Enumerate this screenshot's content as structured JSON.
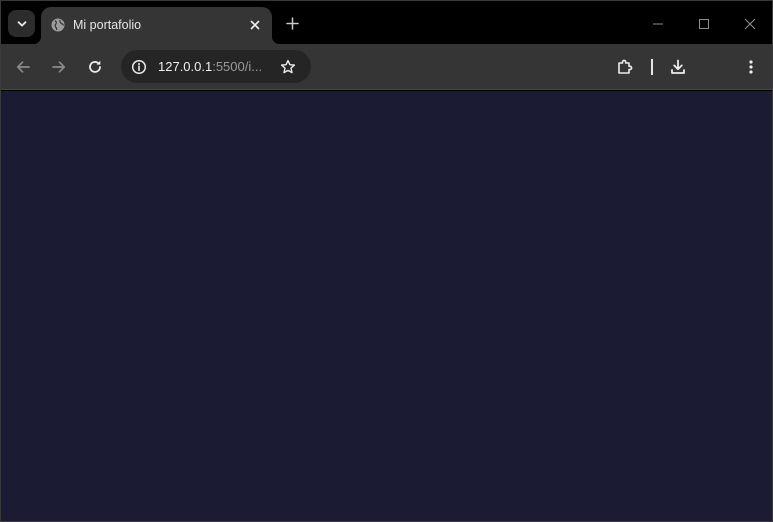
{
  "tabs": [
    {
      "title": "Mi portafolio",
      "favicon": "globe-icon",
      "active": true
    }
  ],
  "omnibox": {
    "url_host": "127.0.0.1",
    "url_path": ":5500/i..."
  },
  "colors": {
    "page_background": "#1b1b33",
    "toolbar": "#353535",
    "tabstrip": "#000000"
  }
}
